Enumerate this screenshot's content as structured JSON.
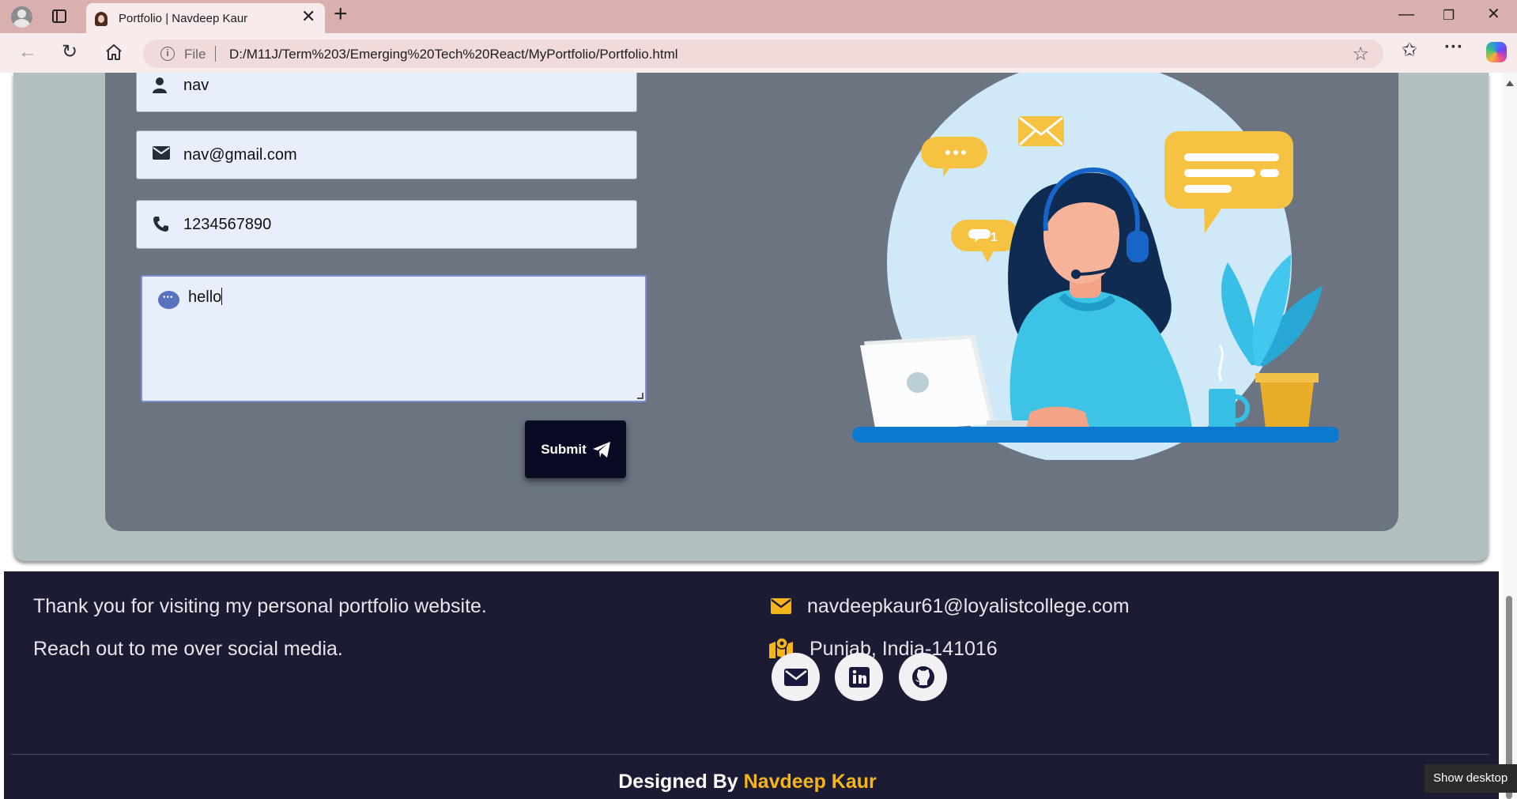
{
  "browser": {
    "tab_title": "Portfolio | Navdeep Kaur",
    "address_scheme": "File",
    "url": "D:/M11J/Term%203/Emerging%20Tech%20React/MyPortfolio/Portfolio.html",
    "icons": [
      "profile-icon",
      "tab-actions-icon",
      "back-icon",
      "refresh-icon",
      "home-icon",
      "info-icon",
      "favorite-star-icon",
      "favorites-icon",
      "more-icon",
      "copilot-icon"
    ]
  },
  "contact_form": {
    "name_value": "nav",
    "email_value": "nav@gmail.com",
    "phone_value": "1234567890",
    "message_value": "hello",
    "submit_label": "Submit"
  },
  "illustration": {
    "badge_count": "1"
  },
  "footer": {
    "thanks_text": "Thank you for visiting my personal portfolio website.",
    "reach_text": "Reach out to me over social media.",
    "email": "navdeepkaur61@loyalistcollege.com",
    "location": "Punjab, India-141016",
    "social_icons": [
      "email-icon",
      "linkedin-icon",
      "github-icon"
    ],
    "designed_by_label": "Designed By",
    "designer_name": "Navdeep Kaur"
  },
  "taskbar": {
    "tooltip": "Show desktop"
  },
  "colors": {
    "accent_yellow": "#f5b51a",
    "footer_bg": "#1b1b33",
    "card_bg": "#6b7480",
    "submit_bg": "#090a24"
  }
}
